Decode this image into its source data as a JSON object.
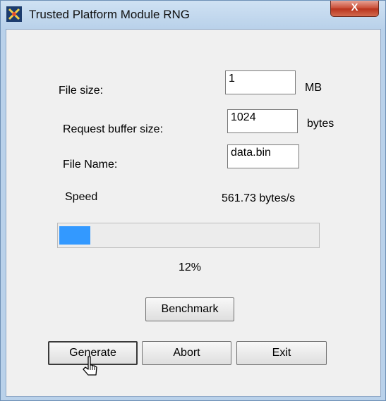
{
  "window": {
    "title": "Trusted Platform Module RNG",
    "close_label": "X"
  },
  "form": {
    "file_size_label": "File size:",
    "file_size_value": "1",
    "file_size_unit": "MB",
    "buffer_label": "Request buffer size:",
    "buffer_value": "1024",
    "buffer_unit": "bytes",
    "file_name_label": "File Name:",
    "file_name_value": "data.bin"
  },
  "status": {
    "speed_label": "Speed",
    "speed_value": "561.73 bytes/s",
    "progress_percent_text": "12%",
    "progress_fraction": 0.12
  },
  "buttons": {
    "benchmark": "Benchmark",
    "generate": "Generate",
    "abort": "Abort",
    "exit": "Exit"
  },
  "colors": {
    "progress_fill": "#3399ff",
    "close_button": "#c94a33"
  },
  "icons": {
    "app": "tpm-app-icon",
    "close": "close-icon",
    "cursor": "mouse-pointer-icon"
  }
}
